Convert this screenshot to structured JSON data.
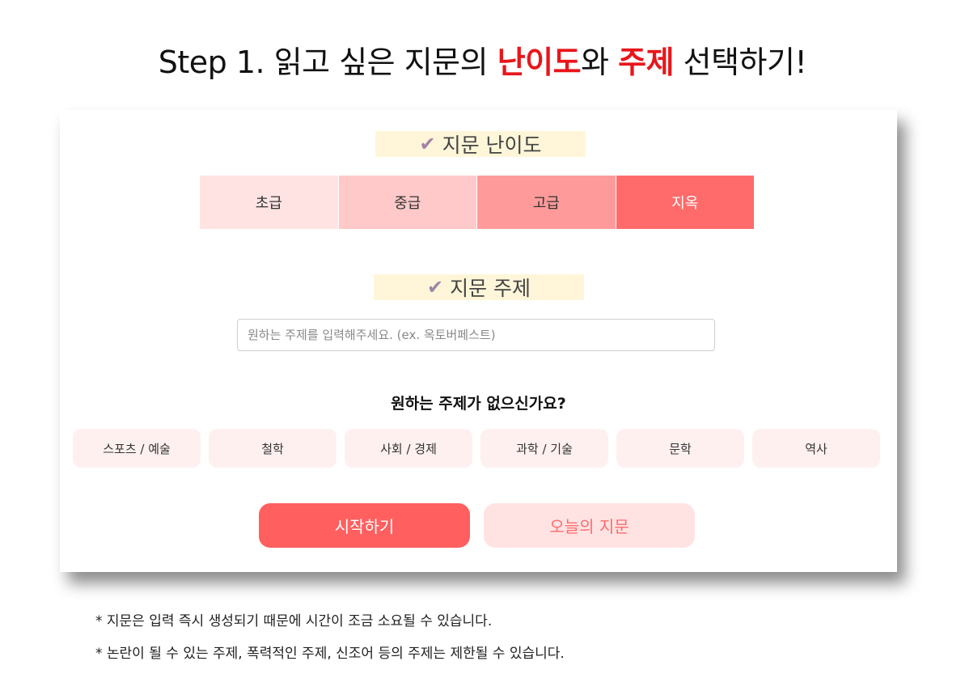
{
  "heading": {
    "prefix": "Step 1. 읽고 싶은 지문의 ",
    "highlight1": "난이도",
    "middle": "와 ",
    "highlight2": "주제",
    "suffix": " 선택하기!"
  },
  "difficulty": {
    "label": "지문 난이도",
    "options": [
      "초급",
      "중급",
      "고급",
      "지옥"
    ]
  },
  "topic": {
    "label": "지문 주제",
    "placeholder": "원하는 주제를 입력해주세요. (ex. 옥토버페스트)",
    "value": ""
  },
  "suggestions": {
    "question": "원하는 주제가 없으신가요?",
    "chips": [
      "스포츠 / 예술",
      "철학",
      "사회 / 경제",
      "과학 / 기술",
      "문학",
      "역사"
    ]
  },
  "actions": {
    "start": "시작하기",
    "today": "오늘의 지문"
  },
  "notes": [
    "* 지문은 입력 즉시 생성되기 때문에 시간이 조금 소요될 수 있습니다.",
    "* 논란이 될 수 있는 주제, 폭력적인 주제, 신조어 등의 주제는 제한될 수 있습니다."
  ],
  "icons": {
    "check": "check-icon"
  },
  "colors": {
    "accent": "#ff5f5f",
    "highlight_text": "#e8161b",
    "label_bg": "#fff6d9"
  }
}
